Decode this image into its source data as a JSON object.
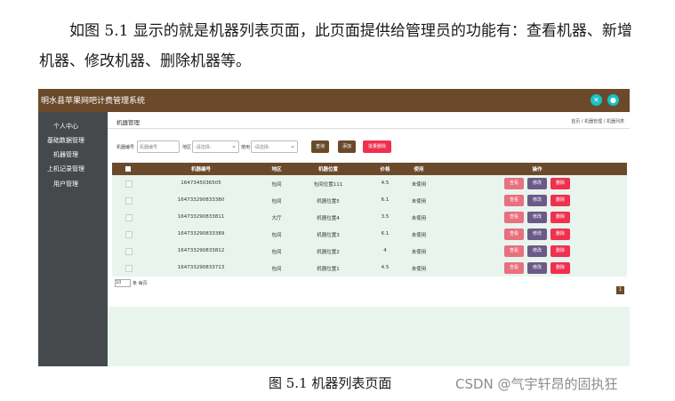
{
  "document": {
    "paragraph": "如图 5.1 显示的就是机器列表页面，此页面提供给管理员的功能有：查看机器、新增机器、修改机器、删除机器等。",
    "caption": "图 5.1  机器列表页面",
    "watermark": "CSDN @气宇轩昂的固执狂"
  },
  "app": {
    "title": "明水县苹果网吧计费管理系统",
    "icons": [
      "close-circle-icon",
      "user-circle-icon"
    ],
    "accent_color": "#6b4a2b",
    "sidebar_color": "#45494c",
    "sidebar": [
      "个人中心",
      "基础数据管理",
      "机器管理",
      "上机记录管理",
      "用户管理"
    ],
    "page_title": "机器管理",
    "breadcrumb": "首页 / 机器管理 / 机器列表",
    "search": {
      "label_number": "机器编号",
      "placeholder_number": "机器编号",
      "label_region": "地区",
      "placeholder_region": "-请选择-",
      "label_usage": "使用",
      "placeholder_usage": "-请选择-",
      "btn_query": "查询",
      "btn_add": "添加",
      "btn_batch_delete": "批量删除"
    },
    "table": {
      "headers": [
        "机器编号",
        "地区",
        "机器位置",
        "价格",
        "使用",
        "操作"
      ],
      "rows": [
        {
          "number": "1647345036505",
          "region": "包间",
          "position": "包间位置111",
          "price": "4.5",
          "usage": "未使用"
        },
        {
          "number": "164733290833380",
          "region": "包间",
          "position": "机器位置5",
          "price": "6.1",
          "usage": "未使用"
        },
        {
          "number": "164733290833811",
          "region": "大厅",
          "position": "机器位置4",
          "price": "3.5",
          "usage": "未使用"
        },
        {
          "number": "164733290833389",
          "region": "包间",
          "position": "机器位置3",
          "price": "6.1",
          "usage": "未使用"
        },
        {
          "number": "164733290833812",
          "region": "包间",
          "position": "机器位置2",
          "price": "4",
          "usage": "未使用"
        },
        {
          "number": "164733290833713",
          "region": "包间",
          "position": "机器位置1",
          "price": "4.5",
          "usage": "未使用"
        }
      ],
      "actions": {
        "view": "查看",
        "edit": "修改",
        "delete": "删除"
      },
      "action_colors": {
        "view": "#e8707f",
        "edit": "#6b5a87",
        "delete": "#f0304f"
      }
    },
    "pagination": {
      "page_size": "10",
      "page_size_suffix": "条 每页",
      "current_page": "1"
    }
  }
}
